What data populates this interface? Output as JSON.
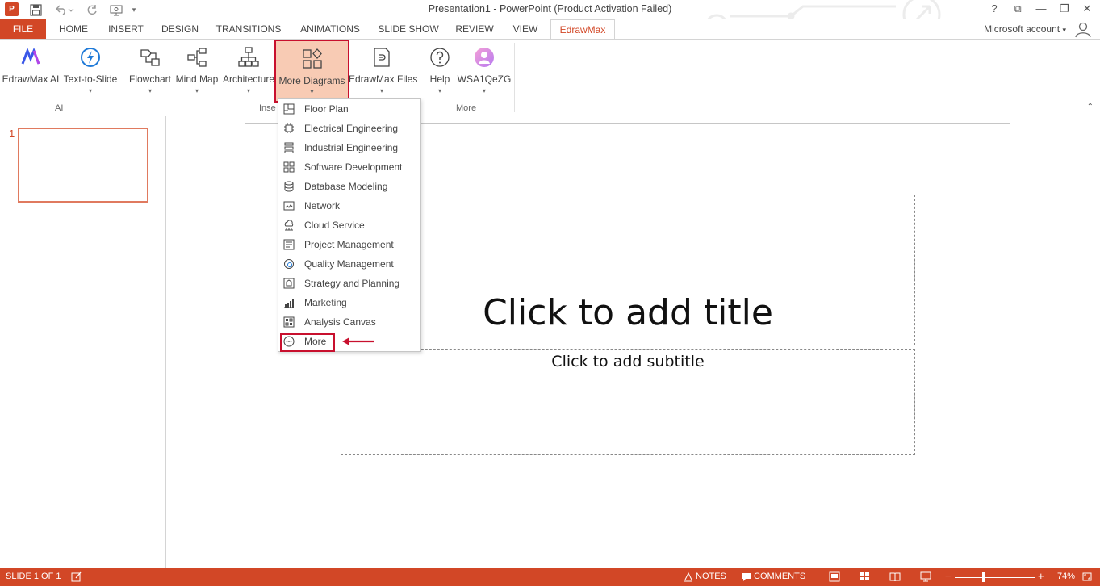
{
  "window": {
    "title": "Presentation1 - PowerPoint (Product Activation Failed)",
    "app_icon": "P",
    "help": "?",
    "restore": "⧉",
    "minimize": "—",
    "maximize": "❐",
    "close": "✕"
  },
  "quick_access": {
    "save": "save-icon",
    "undo": "undo-icon",
    "redo": "redo-icon",
    "present": "present-icon",
    "customize": "customize-icon"
  },
  "tabs": [
    "FILE",
    "HOME",
    "INSERT",
    "DESIGN",
    "TRANSITIONS",
    "ANIMATIONS",
    "SLIDE SHOW",
    "REVIEW",
    "VIEW",
    "EdrawMax"
  ],
  "account": {
    "label": "Microsoft account"
  },
  "ribbon": {
    "buttons": [
      {
        "label": "EdrawMax AI"
      },
      {
        "label": "Text-to-Slide"
      },
      {
        "label": "Flowchart"
      },
      {
        "label": "Mind Map"
      },
      {
        "label": "Architecture"
      },
      {
        "label": "More Diagrams"
      },
      {
        "label": "EdrawMax Files"
      },
      {
        "label": "Help"
      },
      {
        "label": "WSA1QeZG"
      }
    ],
    "groups": {
      "ai": "AI",
      "insert": "Inse",
      "more": "More"
    },
    "caret": "▾"
  },
  "dropdown": {
    "items": [
      {
        "label": "Floor Plan",
        "icon": "floor-plan-icon"
      },
      {
        "label": "Electrical Engineering",
        "icon": "electrical-icon"
      },
      {
        "label": "Industrial Engineering",
        "icon": "industrial-icon"
      },
      {
        "label": "Software Development",
        "icon": "software-icon"
      },
      {
        "label": "Database Modeling",
        "icon": "database-icon"
      },
      {
        "label": "Network",
        "icon": "network-icon"
      },
      {
        "label": "Cloud Service",
        "icon": "cloud-icon"
      },
      {
        "label": "Project Management",
        "icon": "project-icon"
      },
      {
        "label": "Quality Management",
        "icon": "quality-icon"
      },
      {
        "label": "Strategy and Planning",
        "icon": "strategy-icon"
      },
      {
        "label": "Marketing",
        "icon": "marketing-icon"
      },
      {
        "label": "Analysis Canvas",
        "icon": "analysis-icon"
      },
      {
        "label": "More",
        "icon": "more-dots-icon"
      }
    ]
  },
  "slides": {
    "thumb_number": "1"
  },
  "slide": {
    "title_placeholder": "Click to add title",
    "subtitle_placeholder": "Click to add subtitle"
  },
  "status": {
    "slide_counter": "SLIDE 1 OF 1",
    "notes": "NOTES",
    "comments": "COMMENTS",
    "zoom_minus": "−",
    "zoom_plus": "+",
    "zoom": "74%"
  },
  "colors": {
    "accent": "#d24726",
    "highlight": "#c8102e",
    "button_active": "#f8cbb4"
  }
}
